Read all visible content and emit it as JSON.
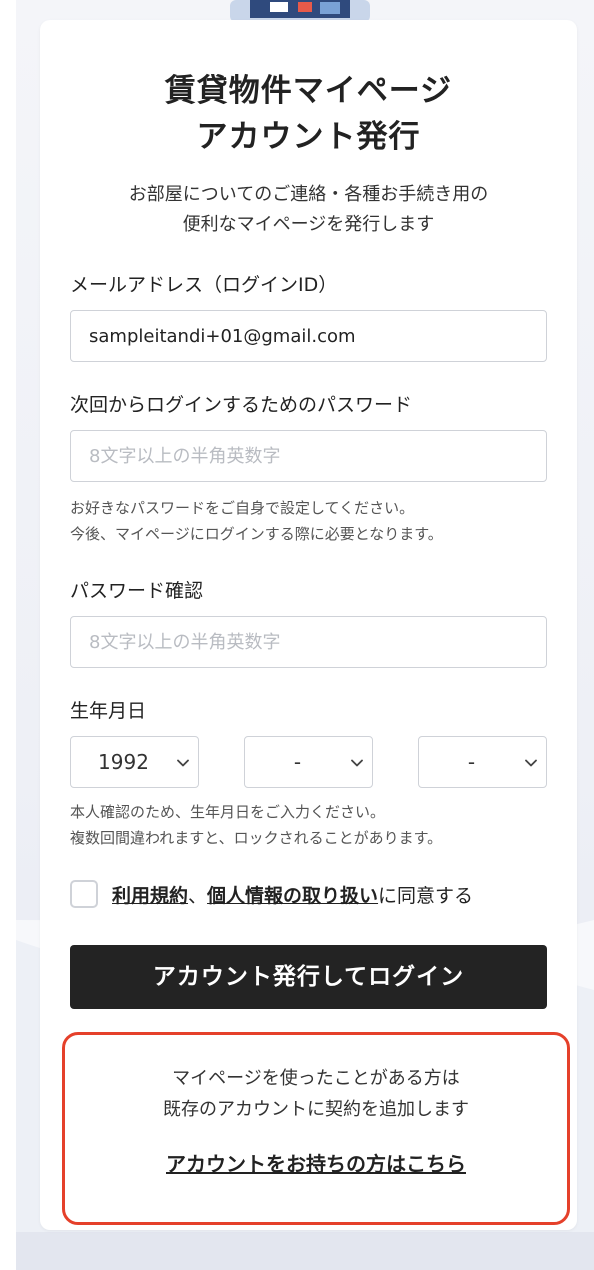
{
  "page": {
    "title_line1": "賃貸物件マイページ",
    "title_line2": "アカウント発行",
    "subtitle_line1": "お部屋についてのご連絡・各種お手続き用の",
    "subtitle_line2": "便利なマイページを発行します"
  },
  "email": {
    "label": "メールアドレス（ログインID）",
    "value": "sampleitandi+01@gmail.com"
  },
  "password": {
    "label": "次回からログインするためのパスワード",
    "placeholder": "8文字以上の半角英数字",
    "help_line1": "お好きなパスワードをご自身で設定してください。",
    "help_line2": "今後、マイページにログインする際に必要となります。"
  },
  "password_confirm": {
    "label": "パスワード確認",
    "placeholder": "8文字以上の半角英数字"
  },
  "birthdate": {
    "label": "生年月日",
    "year": "1992",
    "month": "-",
    "day": "-",
    "help_line1": "本人確認のため、生年月日をご入力ください。",
    "help_line2": "複数回間違われますと、ロックされることがあります。"
  },
  "agreement": {
    "terms_link": "利用規約",
    "separator": "、",
    "privacy_link": "個人情報の取り扱い",
    "suffix": "に同意する",
    "checked": false
  },
  "submit": {
    "label": "アカウント発行してログイン"
  },
  "existing": {
    "line1": "マイページを使ったことがある方は",
    "line2": "既存のアカウントに契約を追加します",
    "link": "アカウントをお持ちの方はこちら",
    "border_color": "#e5402a"
  },
  "colors": {
    "button_bg": "#232323",
    "highlight_border": "#e5402a",
    "background": "#eef0f6"
  }
}
